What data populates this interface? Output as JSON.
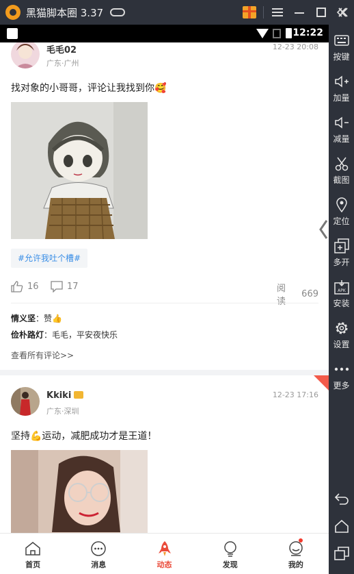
{
  "emulator": {
    "title": "黑猫脚本圈 3.37",
    "window_buttons": [
      "menu",
      "minimize",
      "maximize",
      "close"
    ]
  },
  "sidebar": {
    "items": [
      {
        "label": "按键",
        "icon": "keyboard-icon"
      },
      {
        "label": "加量",
        "icon": "volume-up-icon"
      },
      {
        "label": "减量",
        "icon": "volume-down-icon"
      },
      {
        "label": "截图",
        "icon": "scissors-icon"
      },
      {
        "label": "定位",
        "icon": "location-pin-icon"
      },
      {
        "label": "多开",
        "icon": "multi-window-icon"
      },
      {
        "label": "安装",
        "icon": "apk-install-icon"
      },
      {
        "label": "设置",
        "icon": "gear-icon"
      },
      {
        "label": "更多",
        "icon": "more-dots-icon"
      }
    ],
    "nav": [
      "back-icon",
      "home-icon",
      "recent-apps-icon"
    ]
  },
  "statusbar": {
    "time": "12:22"
  },
  "posts": [
    {
      "username": "毛毛02",
      "location": "广东·广州",
      "time": "12-23 20:08",
      "content": "找对象的小哥哥，评论让我找到你🥰",
      "tag": "#允许我吐个槽#",
      "likes": "16",
      "comments": "17",
      "read_label": "阅读",
      "reads": "669",
      "comment_list": [
        {
          "user": "情义坚",
          "sep": "：",
          "text": "赞👍"
        },
        {
          "user": "俭朴路灯",
          "sep": "：",
          "text": "毛毛，平安夜快乐"
        }
      ],
      "see_all": "查看所有评论>>"
    },
    {
      "username": "Kkiki",
      "location": "广东·深圳",
      "time": "12-23 17:16",
      "content": "坚持💪运动，减肥成功才是王道！"
    }
  ],
  "bottom_nav": [
    {
      "label": "首页",
      "icon": "home-icon"
    },
    {
      "label": "消息",
      "icon": "message-icon"
    },
    {
      "label": "动态",
      "icon": "rocket-icon",
      "active": true
    },
    {
      "label": "发现",
      "icon": "discover-icon"
    },
    {
      "label": "我的",
      "icon": "profile-icon",
      "badge": true
    }
  ],
  "colors": {
    "accent": "#ea4c3b",
    "tag_text": "#3a8ee6"
  }
}
